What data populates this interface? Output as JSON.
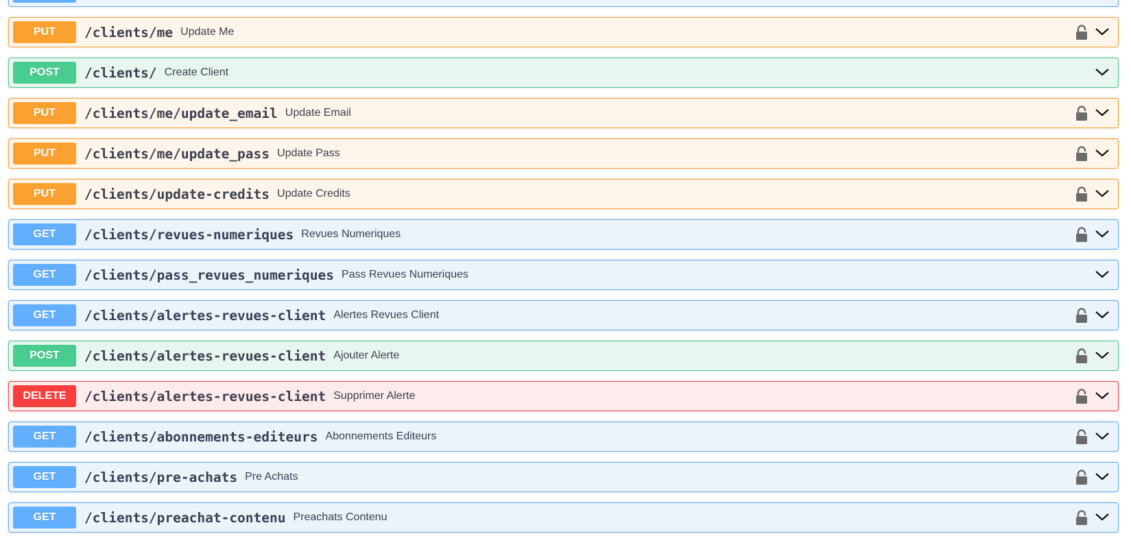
{
  "colors": {
    "get": "#61affe",
    "put": "#fca130",
    "post": "#49cc90",
    "delete": "#f93e3e"
  },
  "endpoints": [
    {
      "method": "PUT",
      "path": "/clients/me",
      "summary": "Update Me",
      "locked": true
    },
    {
      "method": "POST",
      "path": "/clients/",
      "summary": "Create Client",
      "locked": false
    },
    {
      "method": "PUT",
      "path": "/clients/me/update_email",
      "summary": "Update Email",
      "locked": true
    },
    {
      "method": "PUT",
      "path": "/clients/me/update_pass",
      "summary": "Update Pass",
      "locked": true
    },
    {
      "method": "PUT",
      "path": "/clients/update-credits",
      "summary": "Update Credits",
      "locked": true
    },
    {
      "method": "GET",
      "path": "/clients/revues-numeriques",
      "summary": "Revues Numeriques",
      "locked": true
    },
    {
      "method": "GET",
      "path": "/clients/pass_revues_numeriques",
      "summary": "Pass Revues Numeriques",
      "locked": false
    },
    {
      "method": "GET",
      "path": "/clients/alertes-revues-client",
      "summary": "Alertes Revues Client",
      "locked": true
    },
    {
      "method": "POST",
      "path": "/clients/alertes-revues-client",
      "summary": "Ajouter Alerte",
      "locked": true
    },
    {
      "method": "DELETE",
      "path": "/clients/alertes-revues-client",
      "summary": "Supprimer Alerte",
      "locked": true
    },
    {
      "method": "GET",
      "path": "/clients/abonnements-editeurs",
      "summary": "Abonnements Editeurs",
      "locked": true
    },
    {
      "method": "GET",
      "path": "/clients/pre-achats",
      "summary": "Pre Achats",
      "locked": true
    },
    {
      "method": "GET",
      "path": "/clients/preachat-contenu",
      "summary": "Preachats Contenu",
      "locked": true
    }
  ]
}
